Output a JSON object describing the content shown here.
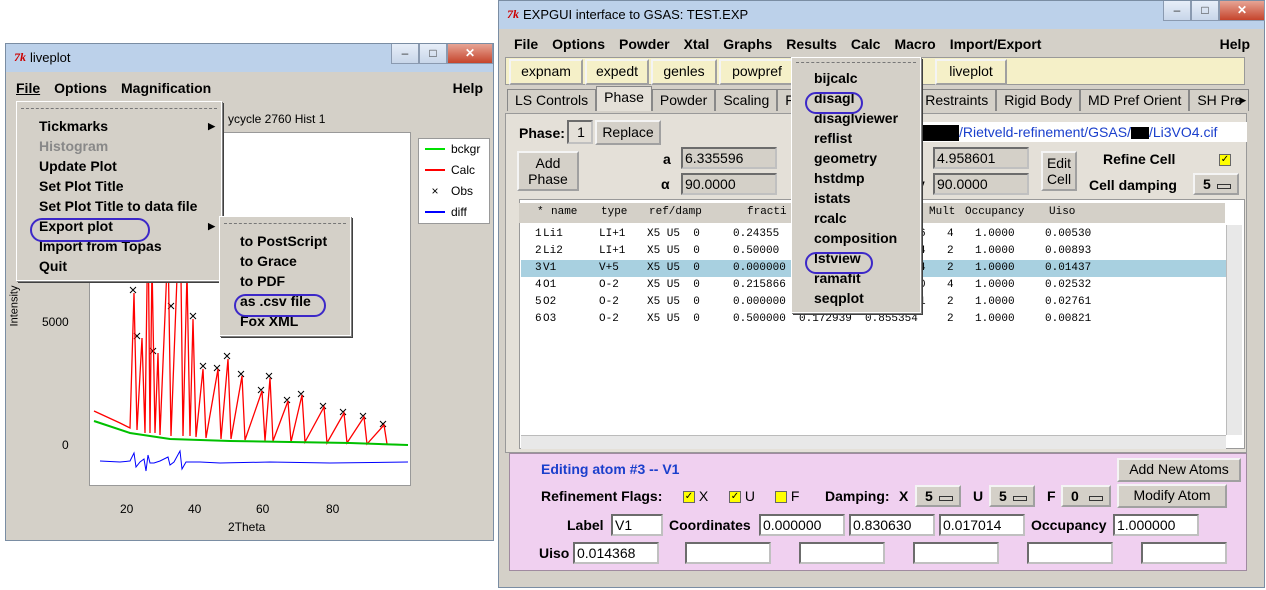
{
  "liveplot": {
    "title": "liveplot",
    "menubar": [
      "File",
      "Options",
      "Magnification"
    ],
    "help": "Help",
    "subtitle": "ycycle 2760 Hist 1",
    "file_menu": [
      "Tickmarks",
      "Histogram",
      "Update Plot",
      "Set Plot Title",
      "Set Plot Title to data file",
      "Export plot",
      "Import from Topas",
      "Quit"
    ],
    "export_menu": [
      "to PostScript",
      "to Grace",
      "to PDF",
      "as .csv file",
      "Fox XML"
    ],
    "legend": [
      "bckgr",
      "Calc",
      "Obs",
      "diff"
    ],
    "colors": {
      "bckgr": "#00e000",
      "Calc": "#ff0000",
      "Obs": "#000000",
      "diff": "#0000ff"
    },
    "ylabel": "Intensity",
    "xlabel": "2Theta",
    "yticks": [
      "5000",
      "0"
    ],
    "xticks": [
      "20",
      "40",
      "60",
      "80"
    ]
  },
  "expgui": {
    "title": "EXPGUI interface to GSAS: TEST.EXP",
    "menubar": [
      "File",
      "Options",
      "Powder",
      "Xtal",
      "Graphs",
      "Results",
      "Calc",
      "Macro",
      "Import/Export"
    ],
    "help": "Help",
    "toolbar": [
      "expnam",
      "expedt",
      "genles",
      "powpref",
      "liveplot"
    ],
    "tabs": [
      "LS Controls",
      "Phase",
      "Powder",
      "Scaling",
      "Restraints",
      "Rigid Body",
      "MD Pref Orient",
      "SH Pre"
    ],
    "results_menu": [
      "bijcalc",
      "disagl",
      "disaglviewer",
      "reflist",
      "geometry",
      "hstdmp",
      "istats",
      "rcalc",
      "composition",
      "lstview",
      "ramafit",
      "seqplot"
    ],
    "phase_label": "Phase:",
    "phase_num": "1",
    "replace": "Replace",
    "add_phase": [
      "Add",
      "Phase"
    ],
    "a_label": "a",
    "a_val": "6.335596",
    "alpha_label": "α",
    "alpha_val": "90.0000",
    "c_val": "4.958601",
    "gamma_val": "90.0000",
    "edit_cell": [
      "Edit",
      "Cell"
    ],
    "refine_cell": "Refine Cell",
    "cell_damping": "Cell damping",
    "cell_damping_val": "5",
    "path": "/Rietveld-refinement/GSAS/",
    "path_file": "/Li3VO4.cif",
    "atom_header": [
      "*",
      "name",
      "type",
      "ref/damp",
      "fracti",
      "Mult",
      "Occupancy",
      "Uiso"
    ],
    "atoms": [
      {
        "n": "1",
        "name": "Li1",
        "type": "LI+1",
        "ref": "X5 U5  0",
        "x": "0.24355",
        "mult": "6",
        "mult2": "4",
        "occ": "1.0000",
        "uiso": "0.00530"
      },
      {
        "n": "2",
        "name": "Li2",
        "type": "LI+1",
        "ref": "X5 U5  0",
        "x": "0.50000",
        "mult": "4",
        "mult2": "2",
        "occ": "1.0000",
        "uiso": "0.00893"
      },
      {
        "n": "3",
        "name": "V1",
        "type": "V+5",
        "ref": "X5 U5  0",
        "x": "0.000000",
        "mult": "4",
        "mult2": "2",
        "occ": "1.0000",
        "uiso": "0.01437"
      },
      {
        "n": "4",
        "name": "O1",
        "type": "O-2",
        "ref": "X5 U5  0",
        "x": "0.215866",
        "mult": "0",
        "mult2": "4",
        "occ": "1.0000",
        "uiso": "0.02532"
      },
      {
        "n": "5",
        "name": "O2",
        "type": "O-2",
        "ref": "X5 U5  0",
        "x": "0.000000",
        "mult": "1",
        "mult2": "2",
        "occ": "1.0000",
        "uiso": "0.02761"
      },
      {
        "n": "6",
        "name": "O3",
        "type": "O-2",
        "ref": "X5 U5  0",
        "x": "0.500000  0.172939  0.855354",
        "mult": "",
        "mult2": "2",
        "occ": "1.0000",
        "uiso": "0.00821"
      }
    ],
    "editing": "Editing atom #3 -- V1",
    "add_new_atoms": "Add New Atoms",
    "ref_flags": "Refinement Flags:",
    "flag_x": "X",
    "flag_u": "U",
    "flag_f": "F",
    "damping": "Damping:",
    "damp_x_label": "X",
    "damp_x": "5",
    "damp_u_label": "U",
    "damp_u": "5",
    "damp_f_label": "F",
    "damp_f": "0",
    "modify_atom": "Modify Atom",
    "label": "Label",
    "label_val": "V1",
    "coordinates": "Coordinates",
    "coord1": "0.000000",
    "coord2": "0.830630",
    "coord3": "0.017014",
    "occupancy": "Occupancy",
    "occupancy_val": "1.000000",
    "uiso": "Uiso",
    "uiso_val": "0.014368"
  }
}
